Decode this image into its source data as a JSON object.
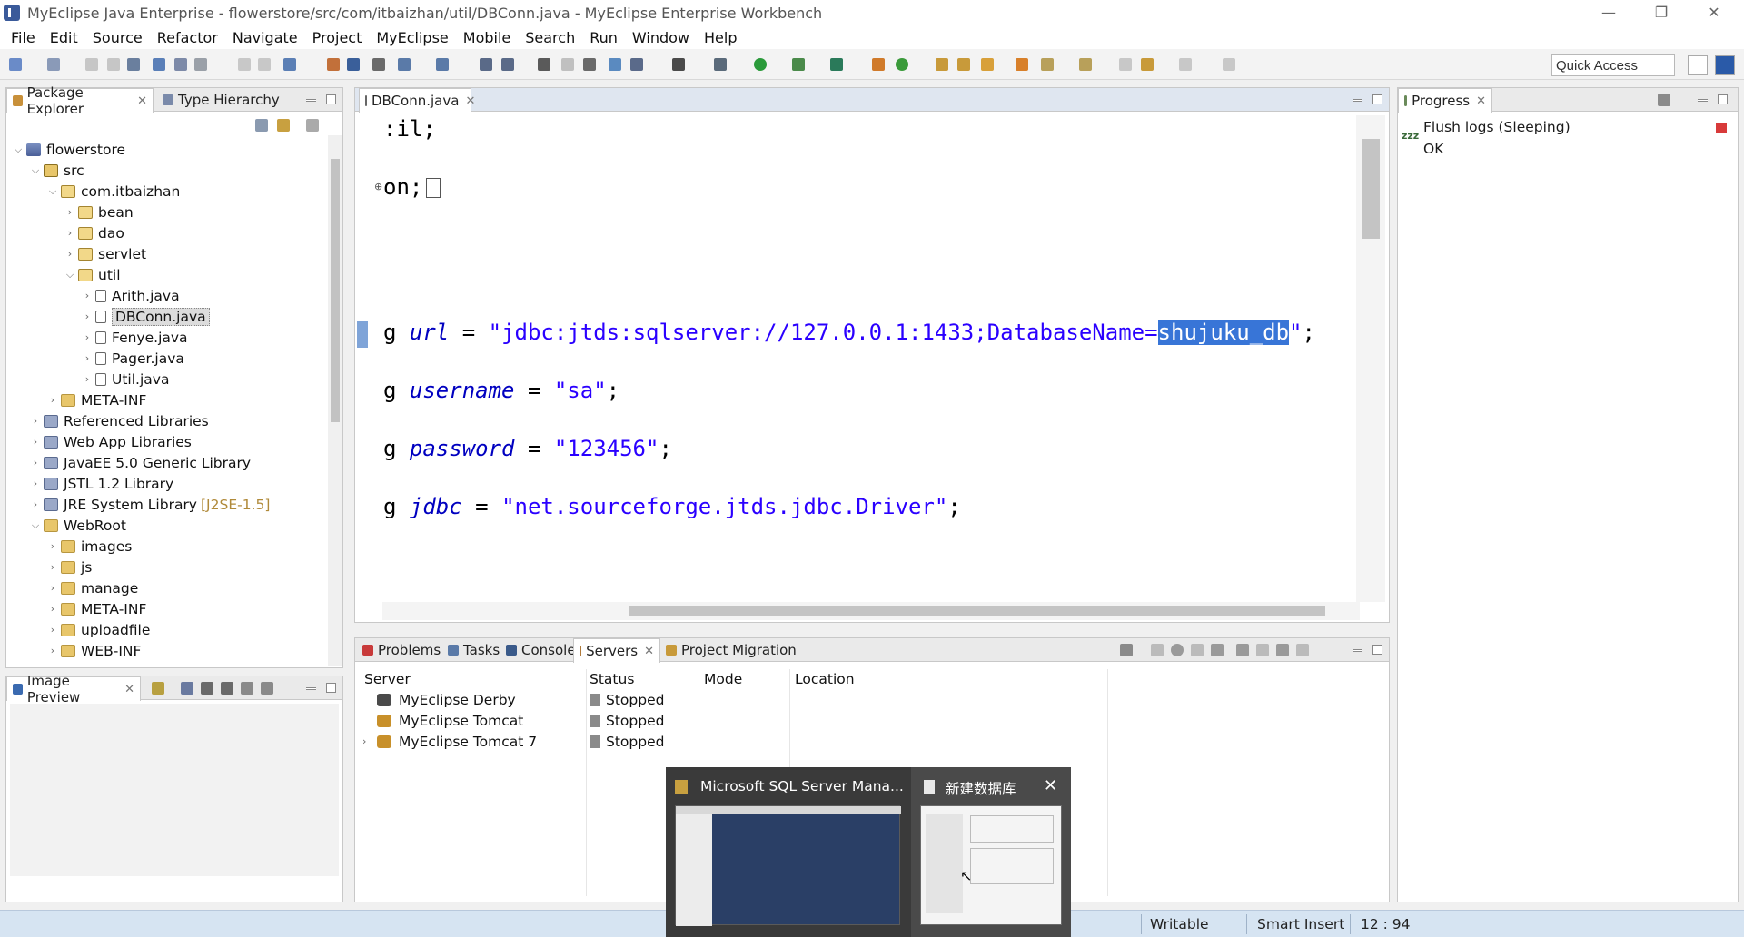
{
  "window": {
    "title": "MyEclipse Java Enterprise - flowerstore/src/com/itbaizhan/util/DBConn.java - MyEclipse Enterprise Workbench",
    "minimize": "—",
    "maximize": "❐",
    "close": "✕"
  },
  "menu": [
    "File",
    "Edit",
    "Source",
    "Refactor",
    "Navigate",
    "Project",
    "MyEclipse",
    "Mobile",
    "Search",
    "Run",
    "Window",
    "Help"
  ],
  "toolbar": {
    "quick_access": "Quick Access"
  },
  "package_explorer": {
    "tabs": [
      {
        "label": "Package Explorer",
        "close": "✕"
      },
      {
        "label": "Type Hierarchy"
      }
    ],
    "tree": [
      {
        "label": "flowerstore",
        "depth": 0,
        "expanded": true,
        "icon": "project"
      },
      {
        "label": "src",
        "depth": 1,
        "expanded": true,
        "icon": "srcfolder"
      },
      {
        "label": "com.itbaizhan",
        "depth": 2,
        "expanded": true,
        "icon": "package"
      },
      {
        "label": "bean",
        "depth": 3,
        "expanded": false,
        "icon": "package"
      },
      {
        "label": "dao",
        "depth": 3,
        "expanded": false,
        "icon": "package"
      },
      {
        "label": "servlet",
        "depth": 3,
        "expanded": false,
        "icon": "package"
      },
      {
        "label": "util",
        "depth": 3,
        "expanded": true,
        "icon": "package"
      },
      {
        "label": "Arith.java",
        "depth": 4,
        "expanded": false,
        "icon": "javafile"
      },
      {
        "label": "DBConn.java",
        "depth": 4,
        "expanded": false,
        "icon": "javafile",
        "selected": true
      },
      {
        "label": "Fenye.java",
        "depth": 4,
        "expanded": false,
        "icon": "javafile"
      },
      {
        "label": "Pager.java",
        "depth": 4,
        "expanded": false,
        "icon": "javafile"
      },
      {
        "label": "Util.java",
        "depth": 4,
        "expanded": false,
        "icon": "javafile"
      },
      {
        "label": "META-INF",
        "depth": 2,
        "expanded": false,
        "icon": "folder"
      },
      {
        "label": "Referenced Libraries",
        "depth": 1,
        "expanded": false,
        "icon": "library"
      },
      {
        "label": "Web App Libraries",
        "depth": 1,
        "expanded": false,
        "icon": "library"
      },
      {
        "label": "JavaEE 5.0 Generic Library",
        "depth": 1,
        "expanded": false,
        "icon": "library"
      },
      {
        "label": "JSTL 1.2 Library",
        "depth": 1,
        "expanded": false,
        "icon": "library"
      },
      {
        "label": "JRE System Library",
        "suffix": "[J2SE-1.5]",
        "depth": 1,
        "expanded": false,
        "icon": "library"
      },
      {
        "label": "WebRoot",
        "depth": 1,
        "expanded": true,
        "icon": "folder"
      },
      {
        "label": "images",
        "depth": 2,
        "expanded": false,
        "icon": "folder"
      },
      {
        "label": "js",
        "depth": 2,
        "expanded": false,
        "icon": "folder"
      },
      {
        "label": "manage",
        "depth": 2,
        "expanded": false,
        "icon": "folder"
      },
      {
        "label": "META-INF",
        "depth": 2,
        "expanded": false,
        "icon": "folder"
      },
      {
        "label": "uploadfile",
        "depth": 2,
        "expanded": false,
        "icon": "folder"
      },
      {
        "label": "WEB-INF",
        "depth": 2,
        "expanded": false,
        "icon": "folder"
      }
    ]
  },
  "image_preview": {
    "tab": "Image Preview",
    "close": "✕"
  },
  "editor": {
    "tab": "DBConn.java",
    "close": "✕",
    "lines": {
      "l1": ":il;",
      "l2": "on;",
      "url_prefix": "g ",
      "url_var": "url",
      "url_eq": " = ",
      "url_str_a": "\"jdbc:jtds:sqlserver://127.0.0.1:1433;DatabaseName=",
      "url_str_sel": "shujuku_db",
      "url_str_b": "\"",
      "url_end": ";",
      "user_prefix": "g ",
      "user_var": "username",
      "user_eq": " = ",
      "user_str": "\"sa\"",
      "user_end": ";",
      "pass_prefix": "g ",
      "pass_var": "password",
      "pass_eq": " = ",
      "pass_str": "\"123456\"",
      "pass_end": ";",
      "jdbc_prefix": "g ",
      "jdbc_var": "jdbc",
      "jdbc_eq": " = ",
      "jdbc_str": "\"net.sourceforge.jtds.jdbc.Driver\"",
      "jdbc_end": ";"
    }
  },
  "progress": {
    "tab": "Progress",
    "close": "✕",
    "zzz": "zzz",
    "job": "Flush logs (Sleeping)",
    "status": "OK"
  },
  "bottom_panel": {
    "tabs": [
      {
        "label": "Problems"
      },
      {
        "label": "Tasks"
      },
      {
        "label": "Console"
      },
      {
        "label": "Servers",
        "close": "✕"
      },
      {
        "label": "Project Migration"
      }
    ],
    "columns": [
      "Server",
      "Status",
      "Mode",
      "Location"
    ],
    "servers": [
      {
        "name": "MyEclipse Derby",
        "status": "Stopped"
      },
      {
        "name": "MyEclipse Tomcat",
        "status": "Stopped"
      },
      {
        "name": "MyEclipse Tomcat 7",
        "status": "Stopped"
      }
    ]
  },
  "taskbar_preview": {
    "left_title": "Microsoft SQL Server Mana...",
    "right_title": "新建数据库",
    "close": "✕"
  },
  "statusbar": {
    "writable": "Writable",
    "insert_mode": "Smart Insert",
    "position": "12 : 94"
  }
}
